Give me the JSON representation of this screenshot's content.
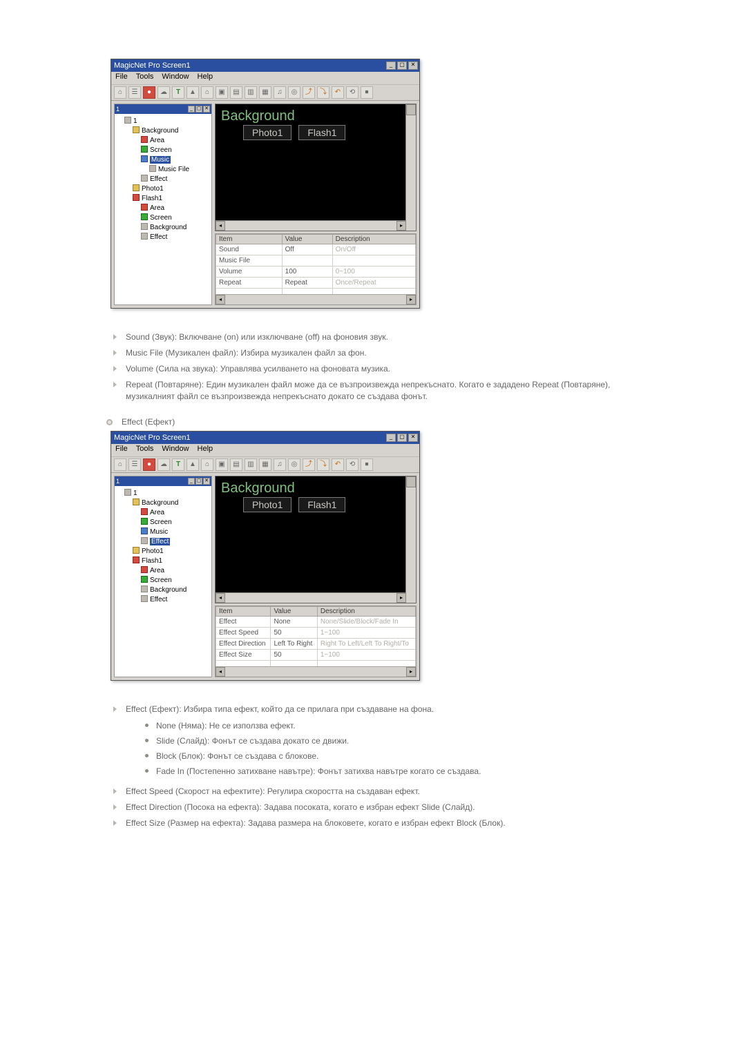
{
  "app": {
    "title": "MagicNet Pro Screen1",
    "menus": [
      "File",
      "Tools",
      "Window",
      "Help"
    ],
    "toolbar_glyphs": [
      "⌂",
      "☰",
      "●",
      "☁",
      "T",
      "▲",
      "⌂",
      "▣",
      "▤",
      "▥",
      "▦",
      "♫",
      "◎",
      "⤴",
      "⤵",
      "↶",
      "⟲",
      "⏹"
    ]
  },
  "tree_panel": {
    "title": "1"
  },
  "screenshot1": {
    "tree": {
      "root": "1",
      "items": [
        {
          "label": "Background",
          "icon": "folder",
          "children": [
            {
              "label": "Area",
              "icon": "red"
            },
            {
              "label": "Screen",
              "icon": "green"
            },
            {
              "label": "Music",
              "icon": "blue",
              "selected": true,
              "children": [
                {
                  "label": "Music File",
                  "icon": "gray"
                }
              ]
            },
            {
              "label": "Effect",
              "icon": "gray"
            }
          ]
        },
        {
          "label": "Photo1",
          "icon": "folder"
        },
        {
          "label": "Flash1",
          "icon": "red",
          "children": [
            {
              "label": "Area",
              "icon": "red"
            },
            {
              "label": "Screen",
              "icon": "green"
            },
            {
              "label": "Background",
              "icon": "gray"
            },
            {
              "label": "Effect",
              "icon": "gray"
            }
          ]
        }
      ]
    },
    "preview": {
      "bg_label": "Background",
      "tabs": [
        "Photo1",
        "Flash1"
      ]
    },
    "grid": {
      "headers": [
        "Item",
        "Value",
        "Description"
      ],
      "rows": [
        {
          "item": "Sound",
          "value": "Off",
          "desc": "On/Off"
        },
        {
          "item": "Music File",
          "value": "",
          "desc": ""
        },
        {
          "item": "Volume",
          "value": "100",
          "desc": "0~100"
        },
        {
          "item": "Repeat",
          "value": "Repeat",
          "desc": "Once/Repeat"
        }
      ]
    }
  },
  "list1": [
    "Sound (Звук): Включване (on) или изключване (off) на фоновия звук.",
    "Music File (Музикален файл): Избира музикален файл за фон.",
    "Volume (Сила на звука): Управлява усилването на фоновата музика.",
    "Repeat (Повтаряне): Един музикален файл може да се възпроизвежда непрекъснато. Когато е зададено Repeat (Повтаряне), музикалният файл се възпроизвежда непрекъснато докато се създава фонът."
  ],
  "section2_head": "Effect (Ефект)",
  "screenshot2": {
    "tree": {
      "root": "1",
      "items": [
        {
          "label": "Background",
          "icon": "folder",
          "children": [
            {
              "label": "Area",
              "icon": "red"
            },
            {
              "label": "Screen",
              "icon": "green"
            },
            {
              "label": "Music",
              "icon": "blue"
            },
            {
              "label": "Effect",
              "icon": "gray",
              "selected": true
            }
          ]
        },
        {
          "label": "Photo1",
          "icon": "folder"
        },
        {
          "label": "Flash1",
          "icon": "red",
          "children": [
            {
              "label": "Area",
              "icon": "red"
            },
            {
              "label": "Screen",
              "icon": "green"
            },
            {
              "label": "Background",
              "icon": "gray"
            },
            {
              "label": "Effect",
              "icon": "gray"
            }
          ]
        }
      ]
    },
    "preview": {
      "bg_label": "Background",
      "tabs": [
        "Photo1",
        "Flash1"
      ]
    },
    "grid": {
      "headers": [
        "Item",
        "Value",
        "Description"
      ],
      "rows": [
        {
          "item": "Effect",
          "value": "None",
          "desc": "None/Slide/Block/Fade In"
        },
        {
          "item": "Effect Speed",
          "value": "50",
          "desc": "1~100"
        },
        {
          "item": "Effect Direction",
          "value": "Left To Right",
          "desc": "Right To Left/Left To Right/To"
        },
        {
          "item": "Effect Size",
          "value": "50",
          "desc": "1~100"
        }
      ]
    }
  },
  "list2_intro": "Effect (Ефект): Избира типа ефект, който да се прилага при създаване на фона.",
  "list2_sub": [
    "None (Няма): Не се използва ефект.",
    "Slide (Слайд): Фонът се създава докато се движи.",
    "Block (Блок): Фонът се създава с блокове.",
    "Fade In (Постепенно затихване навътре): Фонът затихва навътре когато се създава."
  ],
  "list2_rest": [
    "Effect Speed (Скорост на ефектите): Регулира скоростта на създаван ефект.",
    "Effect Direction (Посока на ефекта): Задава посоката, когато е избран ефект Slide (Слайд).",
    "Effect Size (Размер на ефекта): Задава размера на блоковете, когато е избран ефект Block (Блок)."
  ]
}
